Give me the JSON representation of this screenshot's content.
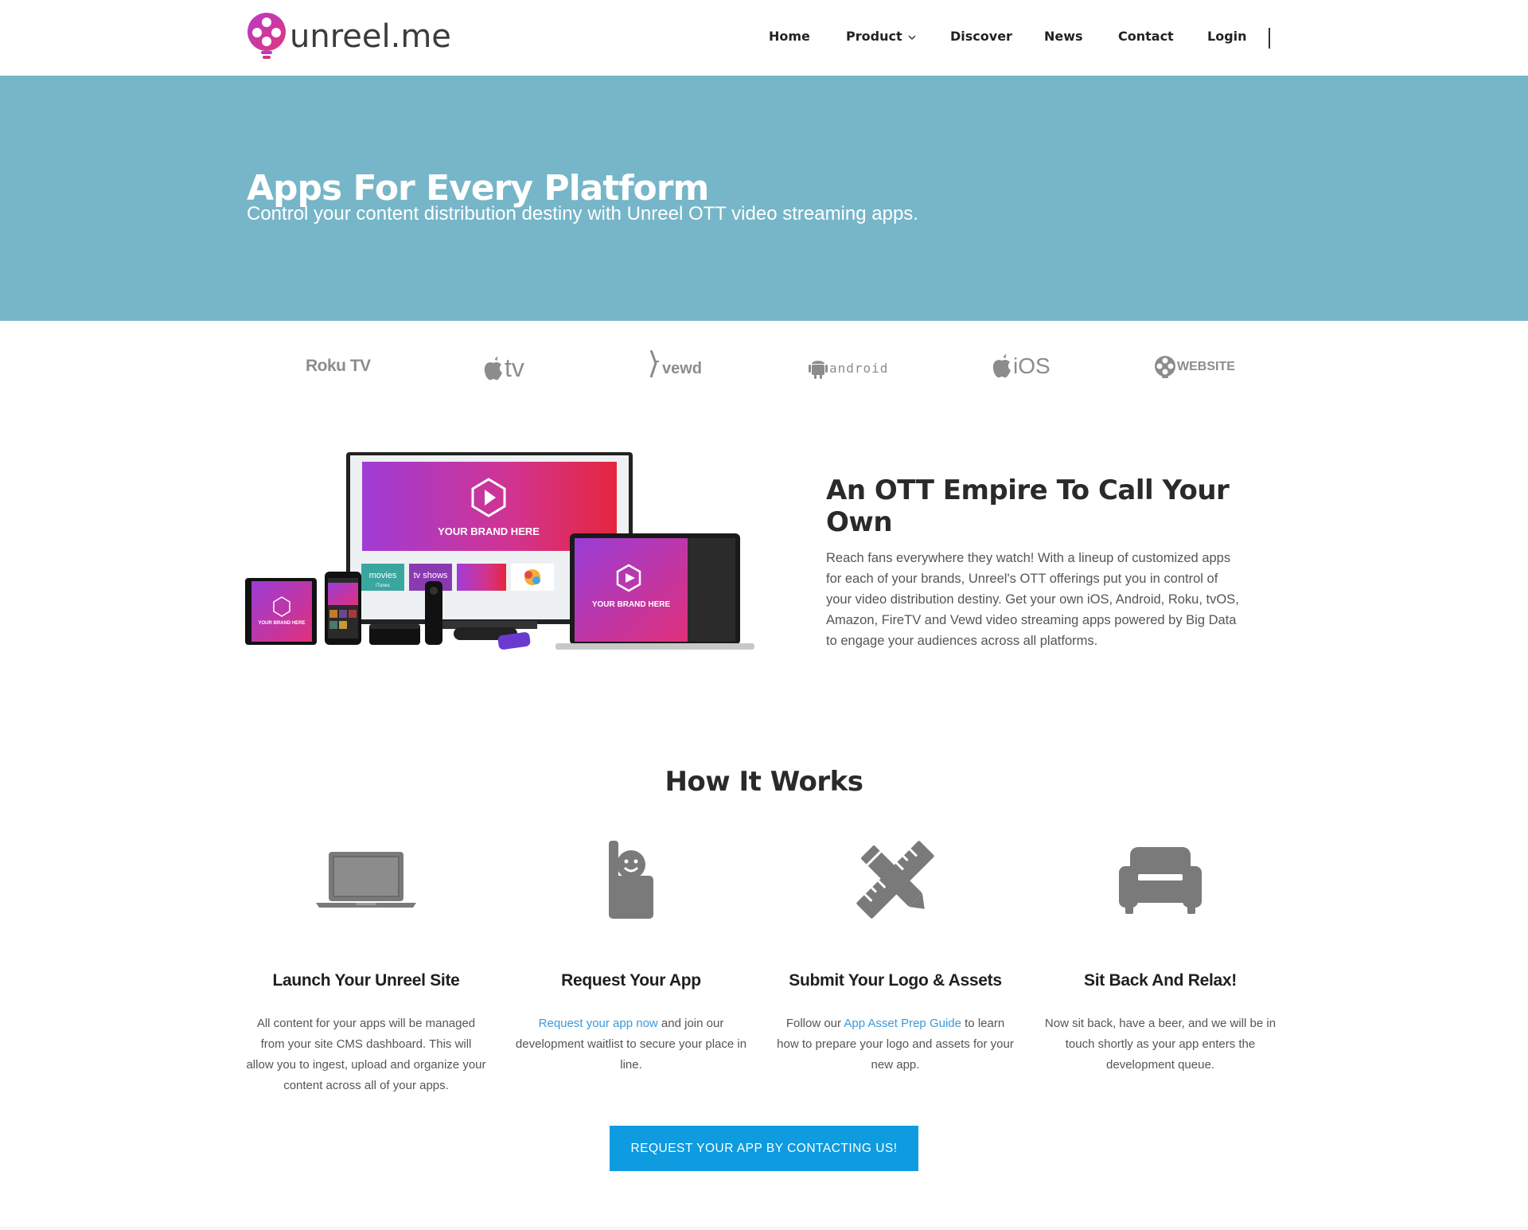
{
  "brand": {
    "name": "unreel.me",
    "accent": "#b83ac6",
    "accent2": "#e0377c"
  },
  "nav": {
    "items": [
      "Home",
      "Product",
      "Discover",
      "News",
      "Contact",
      "Login"
    ]
  },
  "hero": {
    "title": "Apps For Every Platform",
    "subtitle": "Control your content distribution destiny with Unreel OTT video streaming apps.",
    "background": "#76b6c8"
  },
  "platforms": {
    "roku": "Roku TV",
    "appletv": "tv",
    "vewd": "vewd",
    "android": "android",
    "ios": "iOS",
    "website": "WEBSITE"
  },
  "devices": {
    "brand_label": "YOUR BRAND HERE",
    "tile_movies": "movies",
    "tile_movies_sub": "iTunes",
    "tile_tvshows": "tv shows"
  },
  "ott": {
    "title": "An OTT Empire To Call Your Own",
    "body": "Reach fans everywhere they watch! With a lineup of customized apps for each of your brands, Unreel's OTT offerings put you in control of your video distribution destiny. Get your own iOS, Android, Roku, tvOS, Amazon, FireTV and Vewd video streaming apps powered by Big Data to engage your audiences across all platforms."
  },
  "how": {
    "title": "How It Works",
    "steps": [
      {
        "icon": "laptop-icon",
        "title": "Launch Your Unreel Site",
        "desc": "All content for your apps will be managed from your site CMS dashboard.  This will allow you to ingest, upload and organize your content across all of your apps."
      },
      {
        "icon": "hand-icon",
        "title": "Request Your App",
        "link": "Request your app now",
        "desc": " and join our development waitlist to secure your place in line."
      },
      {
        "icon": "ruler-pencil-icon",
        "title": "Submit Your Logo & Assets",
        "pre": "Follow our ",
        "link": "App Asset Prep Guide",
        "desc": " to learn how to prepare your logo and assets for your new app."
      },
      {
        "icon": "sofa-icon",
        "title": "Sit Back And Relax!",
        "desc": "Now sit back, have a beer, and we will be in touch shortly as your app enters the development queue."
      }
    ]
  },
  "cta": {
    "label": "REQUEST YOUR APP BY CONTACTING US!",
    "color": "#0e9be0"
  }
}
